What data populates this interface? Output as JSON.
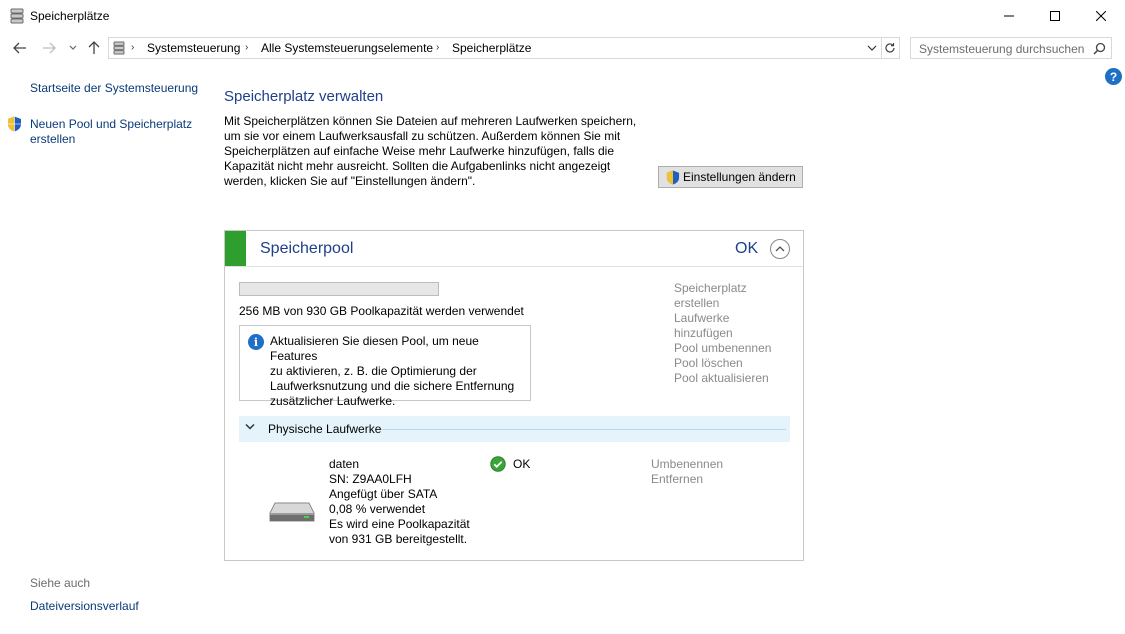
{
  "window": {
    "title": "Speicherplätze"
  },
  "address": {
    "crumbs": [
      "Systemsteuerung",
      "Alle Systemsteuerungselemente",
      "Speicherplätze"
    ],
    "search_placeholder": "Systemsteuerung durchsuchen"
  },
  "left_panel": {
    "home_link": "Startseite der Systemsteuerung",
    "new_pool_line1": "Neuen Pool und Speicherplatz",
    "new_pool_line2": "erstellen",
    "see_also": "Siehe auch",
    "file_history": "Dateiversionsverlauf"
  },
  "main": {
    "title": "Speicherplatz verwalten",
    "description_lines": [
      "Mit Speicherplätzen können Sie Dateien auf mehreren Laufwerken speichern,",
      "um sie vor einem Laufwerksausfall zu schützen. Außerdem können Sie mit",
      "Speicherplätzen auf einfache Weise mehr Laufwerke hinzufügen, falls die",
      "Kapazität nicht mehr ausreicht. Sollten die Aufgabenlinks nicht angezeigt",
      "werden, klicken Sie auf \"Einstellungen ändern\"."
    ],
    "settings_button": "Einstellungen ändern"
  },
  "pool": {
    "name": "Speicherpool",
    "status": "OK",
    "accent_color": "#2e9e2e",
    "usage_fraction": 0.0003,
    "usage_text": "256 MB von 930 GB Poolkapazität werden verwendet",
    "info_lines": [
      "Aktualisieren Sie diesen Pool, um neue Features",
      "zu aktivieren, z. B. die Optimierung der",
      "Laufwerksnutzung und die sichere Entfernung",
      "zusätzlicher Laufwerke."
    ],
    "tasks": [
      "Speicherplatz",
      "erstellen",
      "Laufwerke",
      "hinzufügen",
      "Pool umbenennen",
      "Pool löschen",
      "Pool aktualisieren"
    ],
    "physical_drives_label": "Physische Laufwerke"
  },
  "drive": {
    "lines": [
      "daten",
      "SN: Z9AA0LFH",
      "Angefügt über SATA",
      "0,08 % verwendet",
      "Es wird eine Poolkapazität",
      "von 931 GB bereitgestellt."
    ],
    "status": "OK",
    "tasks": [
      "Umbenennen",
      "Entfernen"
    ]
  }
}
